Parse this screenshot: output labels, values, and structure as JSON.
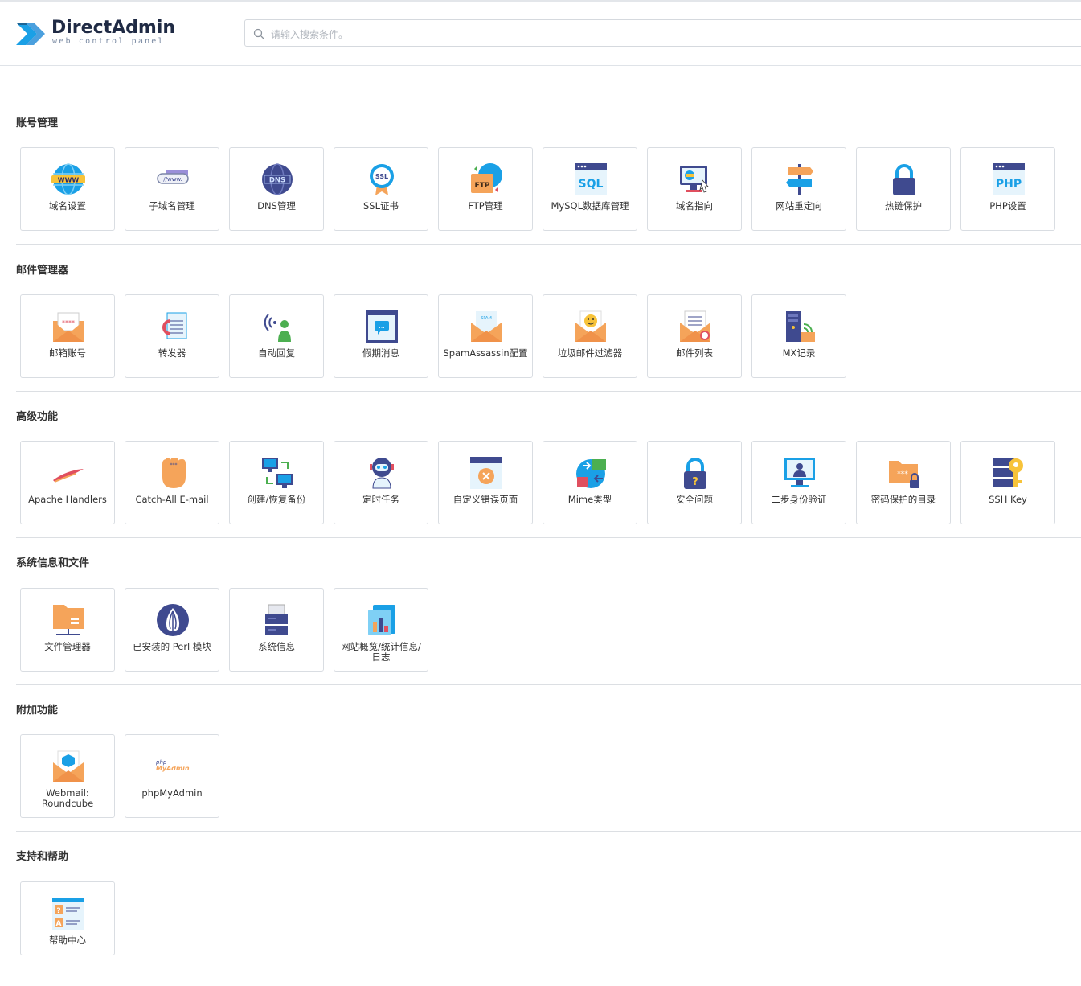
{
  "header": {
    "brand": "DirectAdmin",
    "tagline": "web control panel",
    "search_placeholder": "请输入搜索条件。"
  },
  "sections": [
    {
      "title": "账号管理",
      "items": [
        {
          "label": "域名设置",
          "icon": "globe-www-icon"
        },
        {
          "label": "子域名管理",
          "icon": "subdomain-icon"
        },
        {
          "label": "DNS管理",
          "icon": "dns-globe-icon"
        },
        {
          "label": "SSL证书",
          "icon": "ssl-badge-icon"
        },
        {
          "label": "FTP管理",
          "icon": "ftp-folder-icon"
        },
        {
          "label": "MySQL数据库管理",
          "icon": "sql-database-icon"
        },
        {
          "label": "域名指向",
          "icon": "domain-pointer-icon"
        },
        {
          "label": "网站重定向",
          "icon": "redirect-signpost-icon"
        },
        {
          "label": "热链保护",
          "icon": "padlock-icon"
        },
        {
          "label": "PHP设置",
          "icon": "php-window-icon"
        }
      ]
    },
    {
      "title": "邮件管理器",
      "items": [
        {
          "label": "邮箱账号",
          "icon": "email-account-icon"
        },
        {
          "label": "转发器",
          "icon": "forwarder-icon"
        },
        {
          "label": "自动回复",
          "icon": "autoresponder-icon"
        },
        {
          "label": "假期消息",
          "icon": "vacation-message-icon"
        },
        {
          "label": "SpamAssassin配置",
          "icon": "spam-envelope-icon"
        },
        {
          "label": "垃圾邮件过滤器",
          "icon": "spam-filter-icon"
        },
        {
          "label": "邮件列表",
          "icon": "mailing-list-icon"
        },
        {
          "label": "MX记录",
          "icon": "mx-server-icon"
        }
      ]
    },
    {
      "title": "高级功能",
      "items": [
        {
          "label": "Apache Handlers",
          "icon": "apache-feather-icon"
        },
        {
          "label": "Catch-All E-mail",
          "icon": "catch-hand-icon"
        },
        {
          "label": "创建/恢复备份",
          "icon": "backup-monitors-icon"
        },
        {
          "label": "定时任务",
          "icon": "robot-icon"
        },
        {
          "label": "自定义错误页面",
          "icon": "error-page-icon"
        },
        {
          "label": "Mime类型",
          "icon": "mime-globe-icon"
        },
        {
          "label": "安全问题",
          "icon": "security-question-lock-icon"
        },
        {
          "label": "二步身份验证",
          "icon": "two-factor-monitor-icon"
        },
        {
          "label": "密码保护的目录",
          "icon": "protected-folder-icon"
        },
        {
          "label": "SSH Key",
          "icon": "ssh-key-icon"
        }
      ]
    },
    {
      "title": "系统信息和文件",
      "items": [
        {
          "label": "文件管理器",
          "icon": "file-manager-folder-icon"
        },
        {
          "label": "已安装的 Perl 模块",
          "icon": "perl-onion-icon"
        },
        {
          "label": "系统信息",
          "icon": "system-info-server-icon"
        },
        {
          "label": "网站概览/统计信息/日志",
          "icon": "stats-chart-icon"
        }
      ]
    },
    {
      "title": "附加功能",
      "items": [
        {
          "label": "Webmail: Roundcube",
          "icon": "webmail-envelope-icon"
        },
        {
          "label": "phpMyAdmin",
          "icon": "phpmyadmin-logo-icon"
        }
      ]
    },
    {
      "title": "支持和帮助",
      "items": [
        {
          "label": "帮助中心",
          "icon": "help-center-icon"
        }
      ]
    }
  ],
  "icon_logo_text": {
    "php_small": "php",
    "myadmin": "MyAdmin",
    "dns": "DNS",
    "ssl": "SSL",
    "ftp": "FTP",
    "sql": "SQL",
    "php": "PHP",
    "www": "WWW"
  },
  "colors": {
    "accent": "#1aa0e6",
    "orange": "#f5a45a",
    "navy": "#3f4a8f",
    "card_border": "#d9dde2"
  }
}
